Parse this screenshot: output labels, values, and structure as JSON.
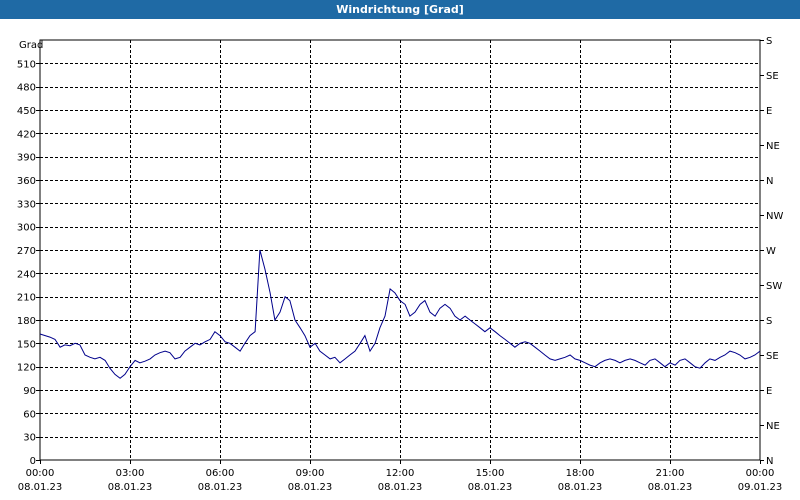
{
  "window": {
    "title": "Windrichtung [Grad]"
  },
  "colors": {
    "titlebar": "#1f6aa5",
    "line": "#00008b",
    "grid": "#000000"
  },
  "chart_data": {
    "type": "line",
    "title": "Windrichtung [Grad]",
    "ylabel": "Grad",
    "xlabel": "",
    "ylim": [
      0,
      540
    ],
    "xlim": [
      0,
      24
    ],
    "grid": true,
    "yticks": [
      0,
      30,
      60,
      90,
      120,
      150,
      180,
      210,
      240,
      270,
      300,
      330,
      360,
      390,
      420,
      450,
      480,
      510
    ],
    "xticks": [
      {
        "x": 0,
        "time": "00:00",
        "date": "08.01.23"
      },
      {
        "x": 3,
        "time": "03:00",
        "date": "08.01.23"
      },
      {
        "x": 6,
        "time": "06:00",
        "date": "08.01.23"
      },
      {
        "x": 9,
        "time": "09:00",
        "date": "08.01.23"
      },
      {
        "x": 12,
        "time": "12:00",
        "date": "08.01.23"
      },
      {
        "x": 15,
        "time": "15:00",
        "date": "08.01.23"
      },
      {
        "x": 18,
        "time": "18:00",
        "date": "08.01.23"
      },
      {
        "x": 21,
        "time": "21:00",
        "date": "08.01.23"
      },
      {
        "x": 24,
        "time": "00:00",
        "date": "09.01.23"
      }
    ],
    "right_axis": [
      {
        "value": 0,
        "label": "N"
      },
      {
        "value": 45,
        "label": "NE"
      },
      {
        "value": 90,
        "label": "E"
      },
      {
        "value": 135,
        "label": "SE"
      },
      {
        "value": 180,
        "label": "S"
      },
      {
        "value": 225,
        "label": "SW"
      },
      {
        "value": 270,
        "label": "W"
      },
      {
        "value": 315,
        "label": "NW"
      },
      {
        "value": 360,
        "label": "N"
      },
      {
        "value": 405,
        "label": "NE"
      },
      {
        "value": 450,
        "label": "E"
      },
      {
        "value": 495,
        "label": "SE"
      },
      {
        "value": 540,
        "label": "S"
      }
    ],
    "series": [
      {
        "x": [
          0,
          0.33,
          0.5,
          0.67,
          0.83,
          1.0,
          1.17,
          1.33,
          1.5,
          1.67,
          1.83,
          2.0,
          2.17,
          2.33,
          2.5,
          2.67,
          2.83,
          3.0,
          3.17,
          3.33,
          3.5,
          3.67,
          3.83,
          4.0,
          4.17,
          4.33,
          4.5,
          4.67,
          4.83,
          5.0,
          5.17,
          5.33,
          5.5,
          5.67,
          5.83,
          6.0,
          6.17,
          6.33,
          6.5,
          6.67,
          6.83,
          7.0,
          7.17,
          7.33,
          7.5,
          7.67,
          7.83,
          8.0,
          8.17,
          8.33,
          8.5,
          8.67,
          8.83,
          9.0,
          9.17,
          9.33,
          9.5,
          9.67,
          9.83,
          10.0,
          10.17,
          10.33,
          10.5,
          10.67,
          10.83,
          11.0,
          11.17,
          11.33,
          11.5,
          11.67,
          11.83,
          12.0,
          12.17,
          12.33,
          12.5,
          12.67,
          12.83,
          13.0,
          13.17,
          13.33,
          13.5,
          13.67,
          13.83,
          14.0,
          14.17,
          14.33,
          14.5,
          14.67,
          14.83,
          15.0,
          15.17,
          15.33,
          15.5,
          15.67,
          15.83,
          16.0,
          16.17,
          16.33,
          16.5,
          16.67,
          16.83,
          17.0,
          17.17,
          17.33,
          17.5,
          17.67,
          17.83,
          18.0,
          18.17,
          18.33,
          18.5,
          18.67,
          18.83,
          19.0,
          19.17,
          19.33,
          19.5,
          19.67,
          19.83,
          20.0,
          20.17,
          20.33,
          20.5,
          20.67,
          20.83,
          21.0,
          21.17,
          21.33,
          21.5,
          21.67,
          21.83,
          22.0,
          22.17,
          22.33,
          22.5,
          22.67,
          22.83,
          23.0,
          23.17,
          23.33,
          23.5,
          23.67,
          23.83,
          24.0
        ],
        "y": [
          162,
          158,
          155,
          145,
          148,
          147,
          150,
          148,
          135,
          132,
          130,
          132,
          128,
          118,
          110,
          105,
          110,
          120,
          128,
          125,
          127,
          130,
          135,
          138,
          140,
          138,
          130,
          132,
          140,
          145,
          150,
          148,
          152,
          155,
          165,
          160,
          152,
          150,
          145,
          140,
          150,
          160,
          165,
          270,
          245,
          215,
          180,
          190,
          210,
          205,
          180,
          170,
          160,
          145,
          150,
          140,
          135,
          130,
          132,
          125,
          130,
          135,
          140,
          150,
          160,
          140,
          150,
          170,
          185,
          220,
          215,
          205,
          200,
          185,
          190,
          200,
          205,
          190,
          185,
          195,
          200,
          195,
          185,
          180,
          185,
          180,
          175,
          170,
          165,
          170,
          165,
          160,
          155,
          150,
          145,
          150,
          152,
          150,
          145,
          140,
          135,
          130,
          128,
          130,
          132,
          135,
          130,
          128,
          125,
          122,
          120,
          125,
          128,
          130,
          128,
          125,
          128,
          130,
          128,
          125,
          122,
          128,
          130,
          125,
          120,
          125,
          122,
          128,
          130,
          125,
          120,
          118,
          125,
          130,
          128,
          132,
          135,
          140,
          138,
          135,
          130,
          132,
          135,
          140
        ]
      }
    ]
  }
}
